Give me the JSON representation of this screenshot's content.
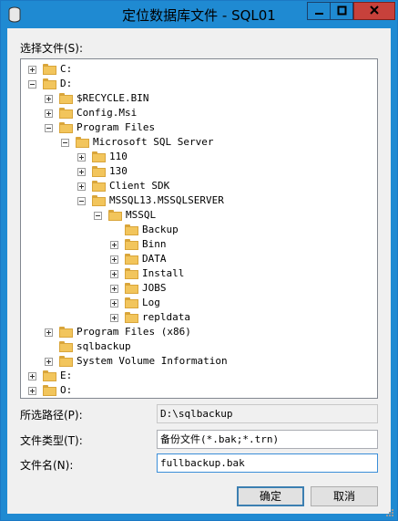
{
  "window": {
    "title": "定位数据库文件 - SQL01"
  },
  "labels": {
    "select_file": "选择文件(S):",
    "selected_path": "所选路径(P):",
    "file_type": "文件类型(T):",
    "file_name": "文件名(N):"
  },
  "tree": [
    {
      "label": "C:",
      "toggle": "plus",
      "folder": true
    },
    {
      "label": "D:",
      "toggle": "minus",
      "folder": true
    },
    {
      "label": "$RECYCLE.BIN",
      "toggle": "plus",
      "folder": true
    },
    {
      "label": "Config.Msi",
      "toggle": "plus",
      "folder": true
    },
    {
      "label": "Program Files",
      "toggle": "minus",
      "folder": true
    },
    {
      "label": "Microsoft SQL Server",
      "toggle": "minus",
      "folder": true
    },
    {
      "label": "110",
      "toggle": "plus",
      "folder": true
    },
    {
      "label": "130",
      "toggle": "plus",
      "folder": true
    },
    {
      "label": "Client SDK",
      "toggle": "plus",
      "folder": true
    },
    {
      "label": "MSSQL13.MSSQLSERVER",
      "toggle": "minus",
      "folder": true
    },
    {
      "label": "MSSQL",
      "toggle": "minus",
      "folder": true
    },
    {
      "label": "Backup",
      "toggle": "none",
      "folder": true
    },
    {
      "label": "Binn",
      "toggle": "plus",
      "folder": true
    },
    {
      "label": "DATA",
      "toggle": "plus",
      "folder": true
    },
    {
      "label": "Install",
      "toggle": "plus",
      "folder": true
    },
    {
      "label": "JOBS",
      "toggle": "plus",
      "folder": true
    },
    {
      "label": "Log",
      "toggle": "plus",
      "folder": true
    },
    {
      "label": "repldata",
      "toggle": "plus",
      "folder": true
    },
    {
      "label": "Program Files (x86)",
      "toggle": "plus",
      "folder": true
    },
    {
      "label": "sqlbackup",
      "toggle": "none",
      "folder": true
    },
    {
      "label": "System Volume Information",
      "toggle": "plus",
      "folder": true
    },
    {
      "label": "E:",
      "toggle": "plus",
      "folder": true
    },
    {
      "label": "O:",
      "toggle": "plus",
      "folder": true
    }
  ],
  "fields": {
    "selected_path": "D:\\sqlbackup",
    "file_type": "备份文件(*.bak;*.trn)",
    "file_name": "fullbackup.bak"
  },
  "buttons": {
    "ok": "确定",
    "cancel": "取消"
  },
  "colors": {
    "titlebar": "#1f8ad2",
    "close": "#c7413b",
    "folder": "#f2c55c"
  }
}
